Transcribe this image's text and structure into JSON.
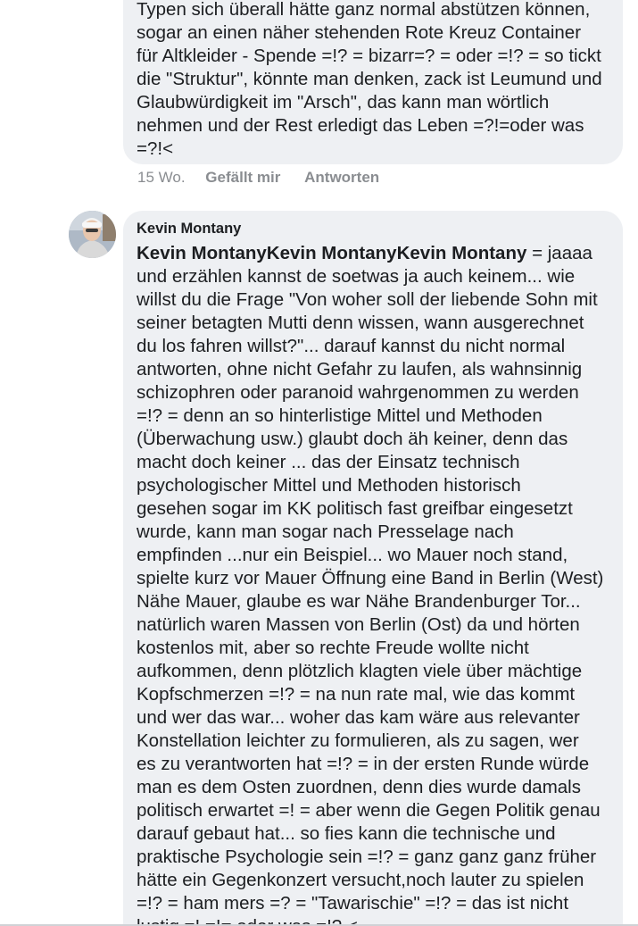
{
  "comments": [
    {
      "text": "Typen sich überall hätte ganz normal abstützen können,\nsogar an einen näher stehenden Rote Kreuz Container\nfür Altkleider - Spende =!? = bizarr=? = oder =!? = so tickt\ndie \"Struktur\", könnte man denken, zack ist Leumund und\nGlaubwürdigkeit im \"Arsch\", das kann man wörtlich\nnehmen und der Rest erledigt das Leben =?!=oder was\n=?!<",
      "time": "15 Wo.",
      "like_label": "Gefällt mir",
      "reply_label": "Antworten"
    },
    {
      "author": "Kevin Montany",
      "mention": "Kevin MontanyKevin MontanyKevin Montany",
      "text": " = jaaaa\nund erzählen kannst de soetwas ja auch keinem... wie\nwillst du die Frage \"Von woher soll der liebende Sohn mit\nseiner betagten Mutti denn wissen, wann ausgerechnet\ndu los fahren willst?\"... darauf kannst du nicht normal\nantworten, ohne nicht Gefahr zu laufen, als wahnsinnig\nschizophren oder paranoid wahrgenommen zu werden\n=!? = denn an so hinterlistige Mittel und Methoden\n(Überwachung usw.) glaubt doch äh keiner, denn das\nmacht doch keiner ... das der Einsatz technisch\npsychologischer Mittel und Methoden historisch\ngesehen sogar im KK  politisch fast greifbar eingesetzt\nwurde, kann man sogar nach Presselage nach\nempfinden ...nur ein Beispiel... wo Mauer noch stand,\nspielte kurz vor Mauer Öffnung eine Band in Berlin (West)\nNähe Mauer, glaube es war Nähe Brandenburger Tor...\nnatürlich waren Massen von Berlin (Ost) da und hörten\nkostenlos mit, aber so rechte Freude wollte nicht\naufkommen, denn plötzlich klagten viele über mächtige\nKopfschmerzen =!? = na nun rate mal, wie das kommt\nund wer das war... woher das kam wäre aus relevanter\nKonstellation leichter zu formulieren, als zu sagen, wer\nes zu verantworten hat =!? = in der ersten Runde würde\nman es dem Osten zuordnen, denn dies wurde damals\npolitisch erwartet =! = aber wenn die Gegen Politik genau\ndarauf gebaut hat... so fies kann die technische und\npraktische Psychologie sein =!? = ganz ganz ganz früher\nhätte ein Gegenkonzert versucht,noch lauter zu spielen\n=!? = ham mers =? = \"Tawarischie\" =!? = das ist nicht\nlustig =! =!= oder was =!? <"
    }
  ],
  "colors": {
    "bubble": "#eef0f3",
    "text": "#1c1e21",
    "meta": "#8a8d91"
  }
}
